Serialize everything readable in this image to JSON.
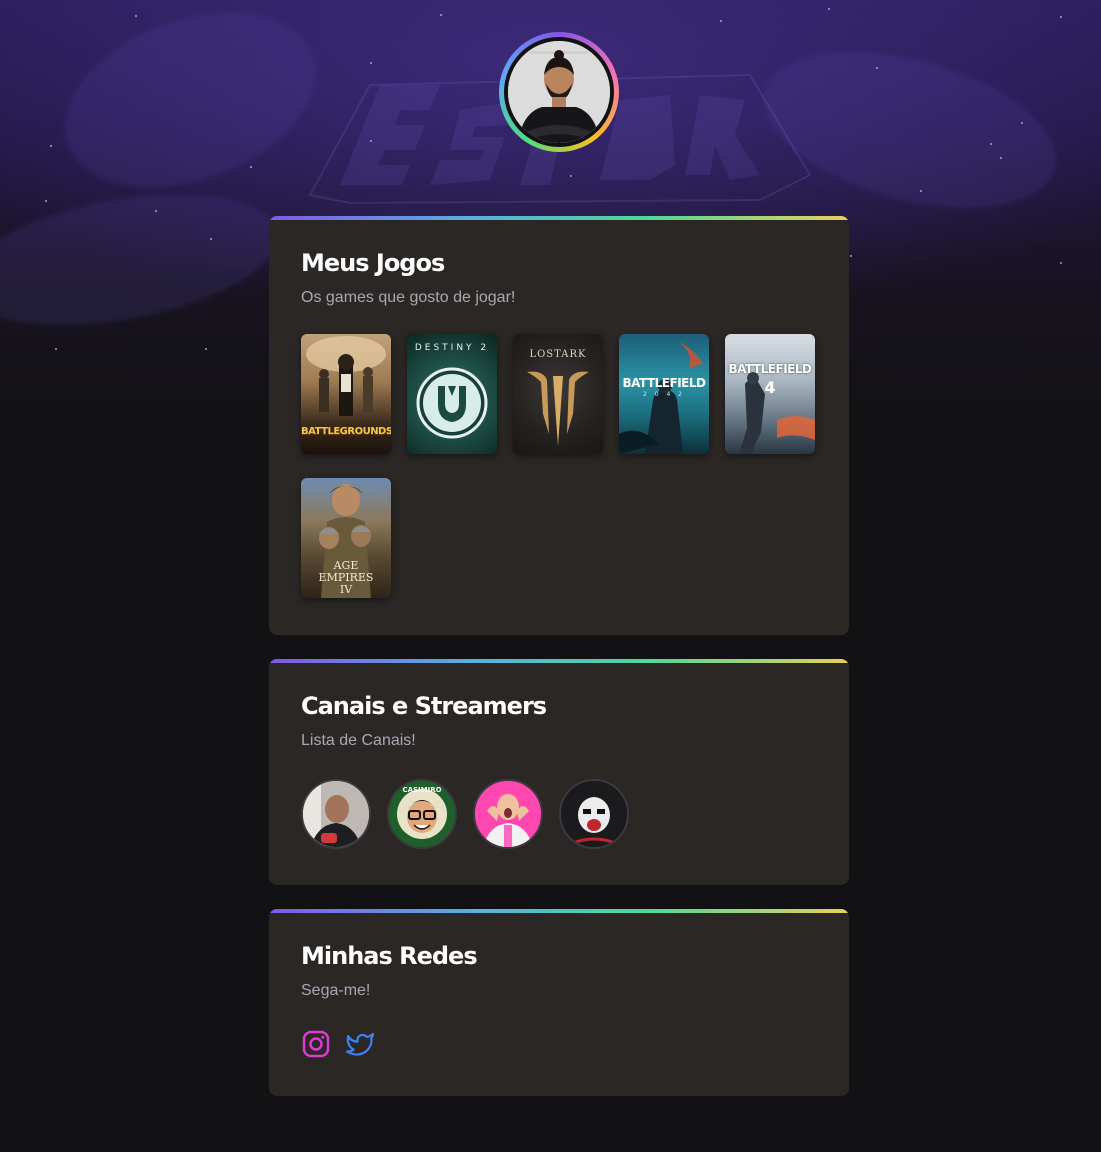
{
  "profile": {
    "avatar_alt": "Foto de perfil"
  },
  "colors": {
    "background": "#121214",
    "card": "#2a2725",
    "accent_gradient": [
      "#8257e5",
      "#5ab0e0",
      "#4fd89a",
      "#e8d05e"
    ],
    "instagram": "#e03bd8",
    "twitter": "#3b82f6"
  },
  "games_section": {
    "title": "Meus Jogos",
    "subtitle": "Os games que gosto de jogar!",
    "games": [
      {
        "name": "PUBG Battlegrounds Mobile",
        "cover_text": "BATTLEGROUNDS"
      },
      {
        "name": "Destiny 2",
        "cover_text": "DESTINY 2"
      },
      {
        "name": "Lost Ark",
        "cover_text": "LOSTARK"
      },
      {
        "name": "Battlefield 2042",
        "cover_text": "BATTLEFIELD"
      },
      {
        "name": "Battlefield 4",
        "cover_text": "BATTLEFIELD"
      },
      {
        "name": "Age of Empires IV",
        "cover_text": "AGE EMPIRES IV"
      }
    ]
  },
  "channels_section": {
    "title": "Canais e Streamers",
    "subtitle": "Lista de Canais!",
    "channels": [
      {
        "icon": "streamer-1-avatar"
      },
      {
        "icon": "casimiro-avatar",
        "badge_text": "CASIMIRO"
      },
      {
        "icon": "streamer-3-avatar"
      },
      {
        "icon": "streamer-4-avatar"
      }
    ]
  },
  "social_section": {
    "title": "Minhas Redes",
    "subtitle": "Sega-me!",
    "links": [
      {
        "icon": "instagram-icon"
      },
      {
        "icon": "twitter-icon"
      }
    ]
  }
}
